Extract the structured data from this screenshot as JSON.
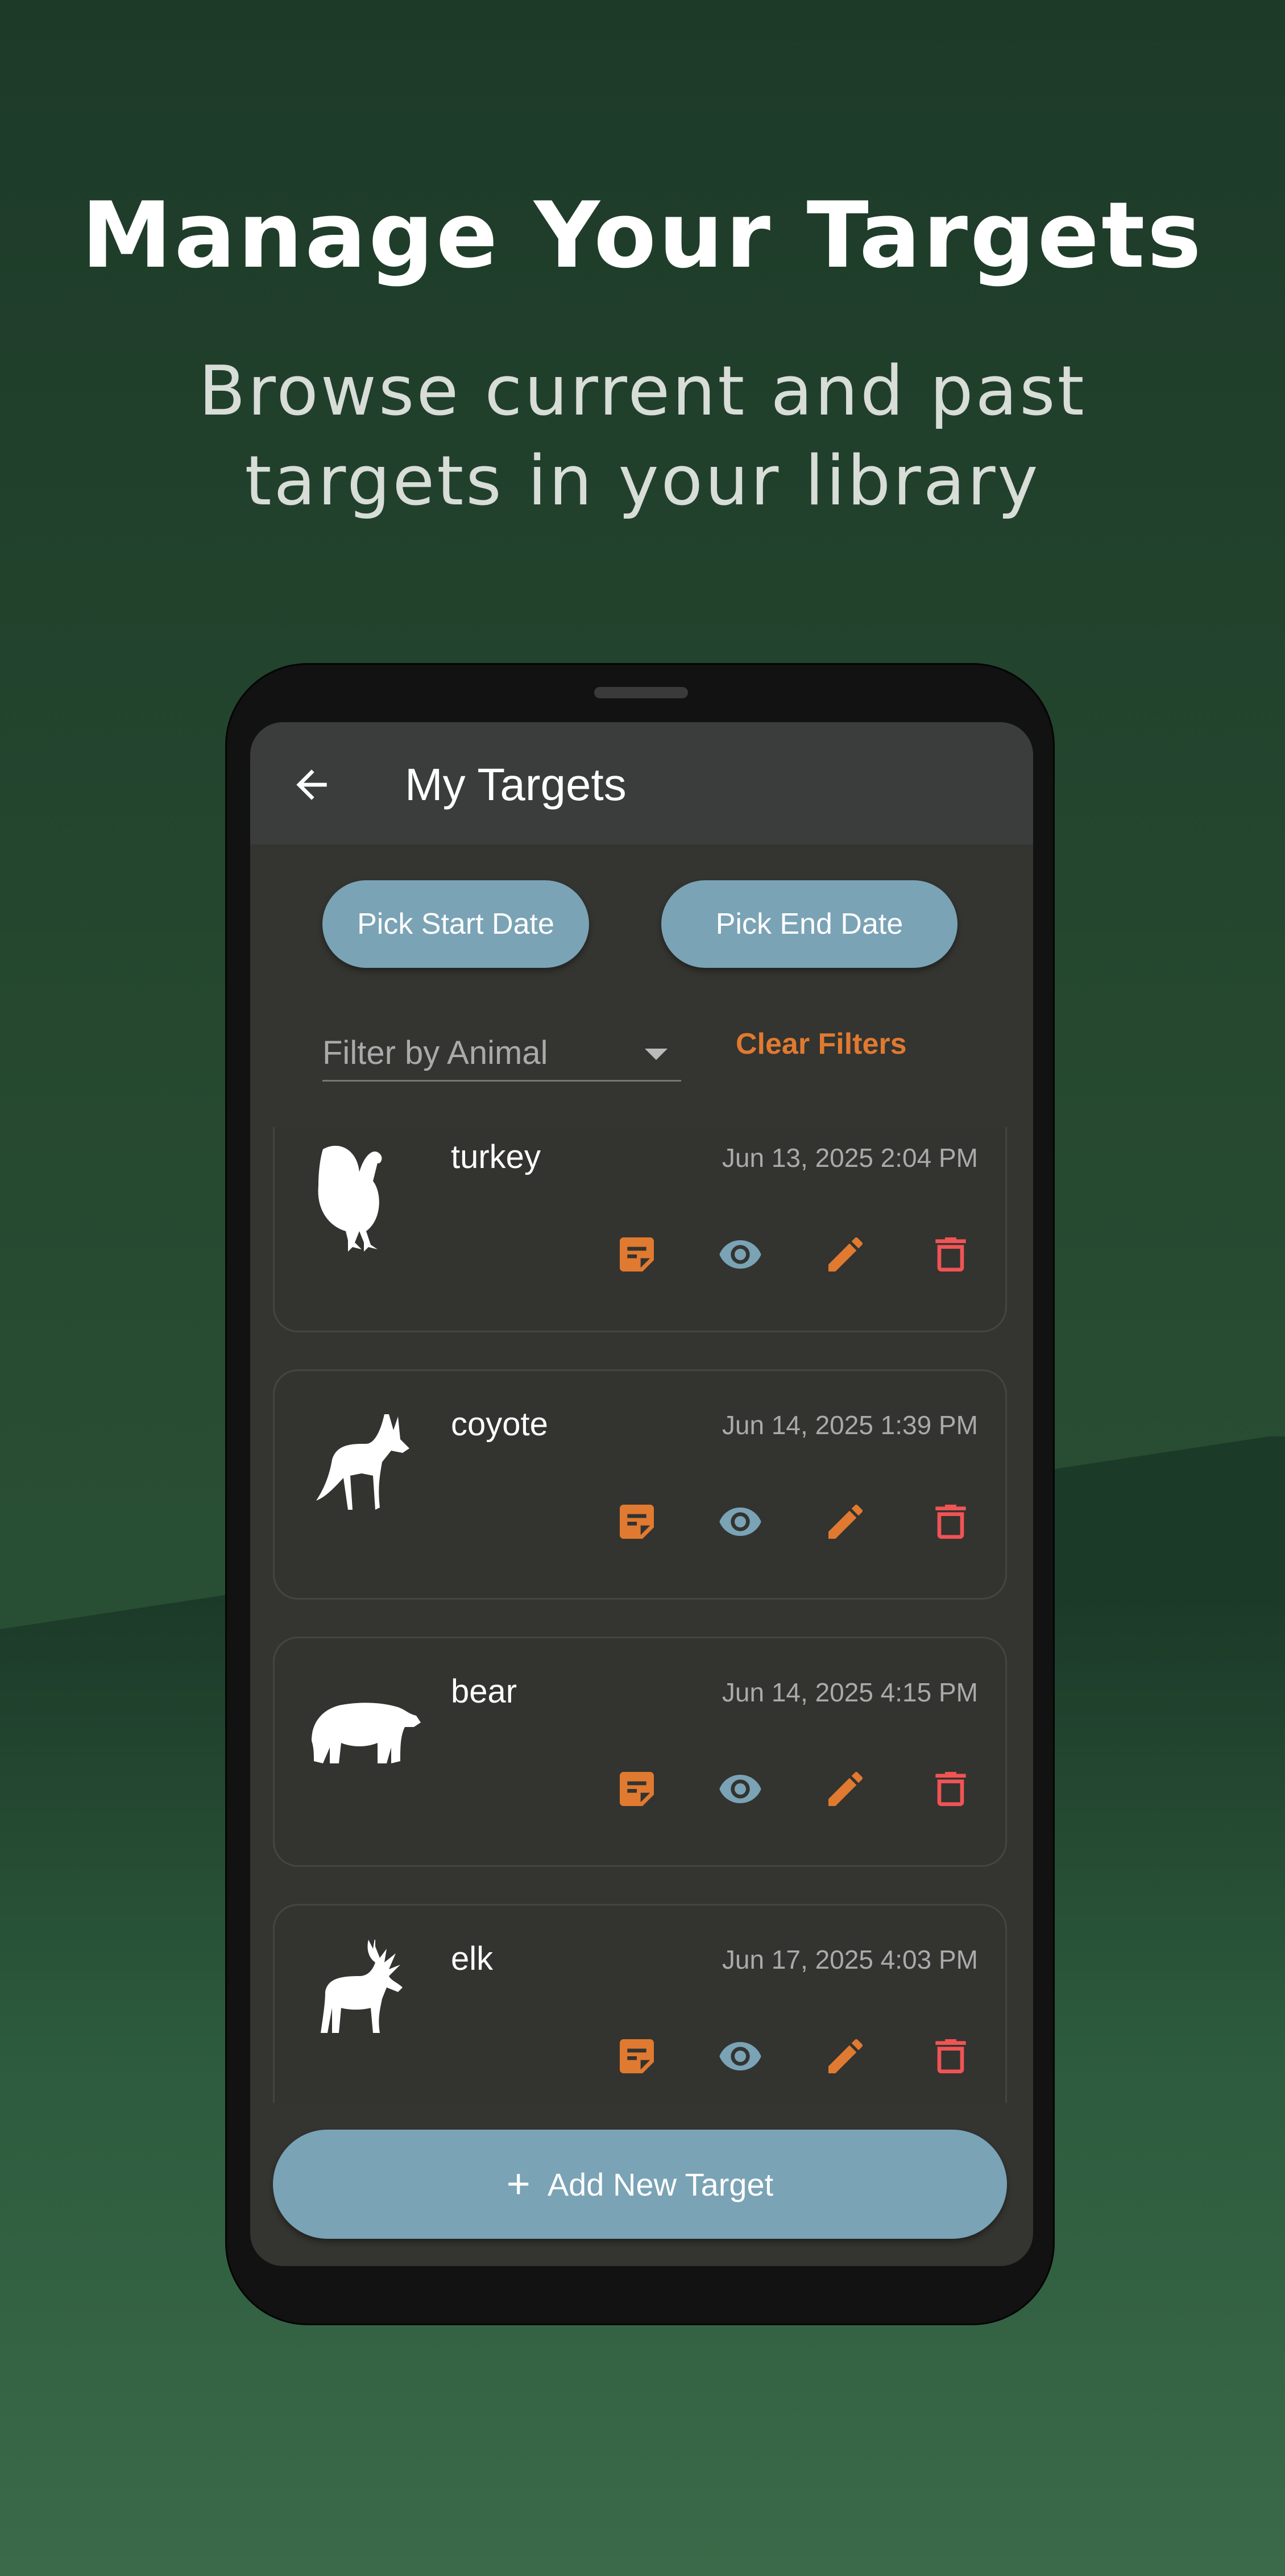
{
  "headline": "Manage Your Targets",
  "subtitle": [
    "Browse current and past",
    "targets in your library"
  ],
  "app": {
    "title": "My Targets",
    "pick_start_label": "Pick Start Date",
    "pick_end_label": "Pick End Date",
    "filter_placeholder": "Filter by Animal",
    "clear_filters_label": "Clear Filters",
    "add_button_label": "Add New Target",
    "add_icon": "+"
  },
  "targets": [
    {
      "name": "turkey",
      "date": "Jun 13, 2025 2:04 PM"
    },
    {
      "name": "coyote",
      "date": "Jun 14, 2025 1:39 PM"
    },
    {
      "name": "bear",
      "date": "Jun 14, 2025 4:15 PM"
    },
    {
      "name": "elk",
      "date": "Jun 17, 2025 4:03 PM"
    }
  ],
  "colors": {
    "accent": "#7aa3b5",
    "orange": "#e07a30",
    "delete": "#f05454"
  }
}
